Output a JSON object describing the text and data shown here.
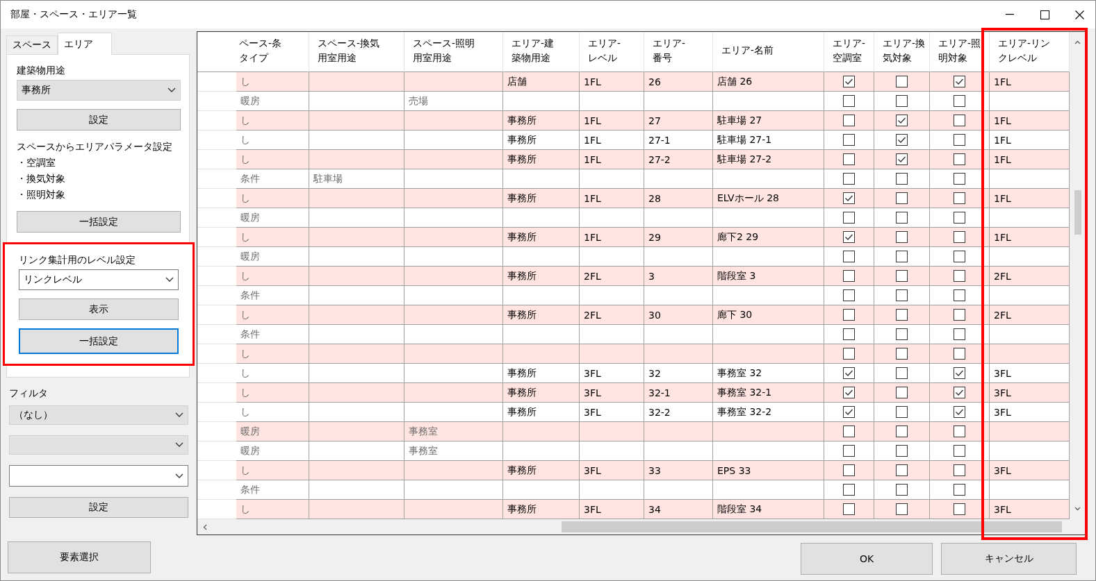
{
  "window": {
    "title": "部屋・スペース・エリア一覧"
  },
  "tabs": [
    {
      "label": "スペース",
      "selected": false
    },
    {
      "label": "エリア",
      "selected": true
    }
  ],
  "area_panel": {
    "building_use_label": "建築物用途",
    "building_use_value": "事務所",
    "set_button": "設定",
    "param_title": "スペースからエリアパラメータ設定",
    "param_items": [
      "・空調室",
      "・換気対象",
      "・照明対象"
    ],
    "bulk_button": "一括設定"
  },
  "level_settings": {
    "label": "リンク集計用のレベル設定",
    "value": "リンクレベル",
    "show_button": "表示",
    "bulk_button": "一括設定",
    "bulk_focused": true,
    "highlighted": true
  },
  "filter": {
    "label": "フィルタ",
    "dropdowns": [
      {
        "kind": "list",
        "value": "（なし）"
      },
      {
        "kind": "list"
      },
      {
        "kind": "editable"
      }
    ],
    "set_button": "設定"
  },
  "select_button": "要素選択",
  "table": {
    "columns": [
      {
        "kind": "readonly",
        "lines": [
          "ペース-条",
          "タイプ"
        ]
      },
      {
        "kind": "readonly",
        "lines": [
          "スペース-換気",
          "用室用途"
        ]
      },
      {
        "kind": "readonly",
        "lines": [
          "スペース-照明",
          "用室用途"
        ]
      },
      {
        "kind": "text",
        "lines": [
          "エリア-建",
          "築物用途"
        ]
      },
      {
        "kind": "text",
        "lines": [
          "エリア-",
          "レベル"
        ]
      },
      {
        "kind": "text",
        "lines": [
          "エリア-",
          "番号"
        ]
      },
      {
        "kind": "text",
        "lines": [
          "エリア-名前"
        ]
      },
      {
        "kind": "check",
        "lines": [
          "エリア-",
          "空調室"
        ]
      },
      {
        "kind": "check",
        "lines": [
          "エリア-換",
          "気対象"
        ]
      },
      {
        "kind": "check",
        "lines": [
          "エリア-照",
          "明対象"
        ]
      },
      {
        "kind": "text",
        "lines": [
          "エリア-リン",
          "クレベル"
        ],
        "highlighted": true
      }
    ],
    "rows": [
      {
        "highlighted": true,
        "cells": [
          {
            "text": "し"
          },
          {},
          {},
          {
            "text": "店舗"
          },
          {
            "text": "1FL"
          },
          {
            "text": "26"
          },
          {
            "text": "店舗 26"
          },
          {
            "checked": true
          },
          {
            "checked": false
          },
          {
            "checked": true
          },
          {
            "text": "1FL"
          }
        ]
      },
      {
        "highlighted": false,
        "cells": [
          {
            "text": "暖房"
          },
          {},
          {
            "text": "売場"
          },
          {},
          {},
          {},
          {},
          {
            "checked": false
          },
          {
            "checked": false
          },
          {
            "checked": false
          },
          {}
        ]
      },
      {
        "highlighted": true,
        "cells": [
          {
            "text": "し"
          },
          {},
          {},
          {
            "text": "事務所"
          },
          {
            "text": "1FL"
          },
          {
            "text": "27"
          },
          {
            "text": "駐車場 27"
          },
          {
            "checked": false
          },
          {
            "checked": true
          },
          {
            "checked": false
          },
          {
            "text": "1FL"
          }
        ]
      },
      {
        "highlighted": false,
        "cells": [
          {
            "text": "し"
          },
          {},
          {},
          {
            "text": "事務所"
          },
          {
            "text": "1FL"
          },
          {
            "text": "27-1"
          },
          {
            "text": "駐車場 27-1"
          },
          {
            "checked": false
          },
          {
            "checked": true
          },
          {
            "checked": false
          },
          {
            "text": "1FL"
          }
        ]
      },
      {
        "highlighted": true,
        "cells": [
          {
            "text": "し"
          },
          {},
          {},
          {
            "text": "事務所"
          },
          {
            "text": "1FL"
          },
          {
            "text": "27-2"
          },
          {
            "text": "駐車場 27-2"
          },
          {
            "checked": false
          },
          {
            "checked": true
          },
          {
            "checked": false
          },
          {
            "text": "1FL"
          }
        ]
      },
      {
        "highlighted": false,
        "cells": [
          {
            "text": "条件"
          },
          {
            "text": "駐車場"
          },
          {},
          {},
          {},
          {},
          {},
          {
            "checked": false
          },
          {
            "checked": false
          },
          {
            "checked": false
          },
          {}
        ]
      },
      {
        "highlighted": true,
        "cells": [
          {
            "text": "し"
          },
          {},
          {},
          {
            "text": "事務所"
          },
          {
            "text": "1FL"
          },
          {
            "text": "28"
          },
          {
            "text": "ELVホール 28"
          },
          {
            "checked": true
          },
          {
            "checked": false
          },
          {
            "checked": false
          },
          {
            "text": "1FL"
          }
        ]
      },
      {
        "highlighted": false,
        "cells": [
          {
            "text": "暖房"
          },
          {},
          {},
          {},
          {},
          {},
          {},
          {
            "checked": false
          },
          {
            "checked": false
          },
          {
            "checked": false
          },
          {}
        ]
      },
      {
        "highlighted": true,
        "cells": [
          {
            "text": "し"
          },
          {},
          {},
          {
            "text": "事務所"
          },
          {
            "text": "1FL"
          },
          {
            "text": "29"
          },
          {
            "text": "廊下2 29"
          },
          {
            "checked": true
          },
          {
            "checked": false
          },
          {
            "checked": false
          },
          {
            "text": "1FL"
          }
        ]
      },
      {
        "highlighted": false,
        "cells": [
          {
            "text": "暖房"
          },
          {},
          {},
          {},
          {},
          {},
          {},
          {
            "checked": false
          },
          {
            "checked": false
          },
          {
            "checked": false
          },
          {}
        ]
      },
      {
        "highlighted": true,
        "cells": [
          {
            "text": "し"
          },
          {},
          {},
          {
            "text": "事務所"
          },
          {
            "text": "2FL"
          },
          {
            "text": "3"
          },
          {
            "text": "階段室 3"
          },
          {
            "checked": false
          },
          {
            "checked": false
          },
          {
            "checked": false
          },
          {
            "text": "2FL"
          }
        ]
      },
      {
        "highlighted": false,
        "cells": [
          {
            "text": "条件"
          },
          {},
          {},
          {},
          {},
          {},
          {},
          {
            "checked": false
          },
          {
            "checked": false
          },
          {
            "checked": false
          },
          {}
        ]
      },
      {
        "highlighted": true,
        "cells": [
          {
            "text": "し"
          },
          {},
          {},
          {
            "text": "事務所"
          },
          {
            "text": "2FL"
          },
          {
            "text": "30"
          },
          {
            "text": "廊下 30"
          },
          {
            "checked": false
          },
          {
            "checked": false
          },
          {
            "checked": false
          },
          {
            "text": "2FL"
          }
        ]
      },
      {
        "highlighted": false,
        "cells": [
          {
            "text": "条件"
          },
          {},
          {},
          {},
          {},
          {},
          {},
          {
            "checked": false
          },
          {
            "checked": false
          },
          {
            "checked": false
          },
          {}
        ]
      },
      {
        "highlighted": true,
        "cells": [
          {
            "text": "し"
          },
          {},
          {},
          {},
          {},
          {},
          {},
          {
            "checked": false
          },
          {
            "checked": false
          },
          {
            "checked": false
          },
          {}
        ]
      },
      {
        "highlighted": false,
        "cells": [
          {
            "text": "し"
          },
          {},
          {},
          {
            "text": "事務所"
          },
          {
            "text": "3FL"
          },
          {
            "text": "32"
          },
          {
            "text": "事務室 32"
          },
          {
            "checked": true
          },
          {
            "checked": false
          },
          {
            "checked": true
          },
          {
            "text": "3FL"
          }
        ]
      },
      {
        "highlighted": true,
        "cells": [
          {
            "text": "し"
          },
          {},
          {},
          {
            "text": "事務所"
          },
          {
            "text": "3FL"
          },
          {
            "text": "32-1"
          },
          {
            "text": "事務室 32-1"
          },
          {
            "checked": true
          },
          {
            "checked": false
          },
          {
            "checked": true
          },
          {
            "text": "3FL"
          }
        ]
      },
      {
        "highlighted": false,
        "cells": [
          {
            "text": "し"
          },
          {},
          {},
          {
            "text": "事務所"
          },
          {
            "text": "3FL"
          },
          {
            "text": "32-2"
          },
          {
            "text": "事務室 32-2"
          },
          {
            "checked": true
          },
          {
            "checked": false
          },
          {
            "checked": true
          },
          {
            "text": "3FL"
          }
        ]
      },
      {
        "highlighted": true,
        "cells": [
          {
            "text": "暖房"
          },
          {},
          {
            "text": "事務室"
          },
          {},
          {},
          {},
          {},
          {
            "checked": false
          },
          {
            "checked": false
          },
          {
            "checked": false
          },
          {}
        ]
      },
      {
        "highlighted": false,
        "cells": [
          {
            "text": "暖房"
          },
          {},
          {
            "text": "事務室"
          },
          {},
          {},
          {},
          {},
          {
            "checked": false
          },
          {
            "checked": false
          },
          {
            "checked": false
          },
          {}
        ]
      },
      {
        "highlighted": true,
        "cells": [
          {
            "text": "し"
          },
          {},
          {},
          {
            "text": "事務所"
          },
          {
            "text": "3FL"
          },
          {
            "text": "33"
          },
          {
            "text": "EPS 33"
          },
          {
            "checked": false
          },
          {
            "checked": false
          },
          {
            "checked": false
          },
          {
            "text": "3FL"
          }
        ]
      },
      {
        "highlighted": false,
        "cells": [
          {
            "text": "条件"
          },
          {},
          {},
          {},
          {},
          {},
          {},
          {
            "checked": false
          },
          {
            "checked": false
          },
          {
            "checked": false
          },
          {}
        ]
      },
      {
        "highlighted": true,
        "cells": [
          {
            "text": "し"
          },
          {},
          {},
          {
            "text": "事務所"
          },
          {
            "text": "3FL"
          },
          {
            "text": "34"
          },
          {
            "text": "階段室 34"
          },
          {
            "checked": false
          },
          {
            "checked": false
          },
          {
            "checked": false
          },
          {
            "text": "3FL"
          }
        ]
      }
    ]
  },
  "buttons": {
    "ok": "OK",
    "cancel": "キャンセル"
  }
}
